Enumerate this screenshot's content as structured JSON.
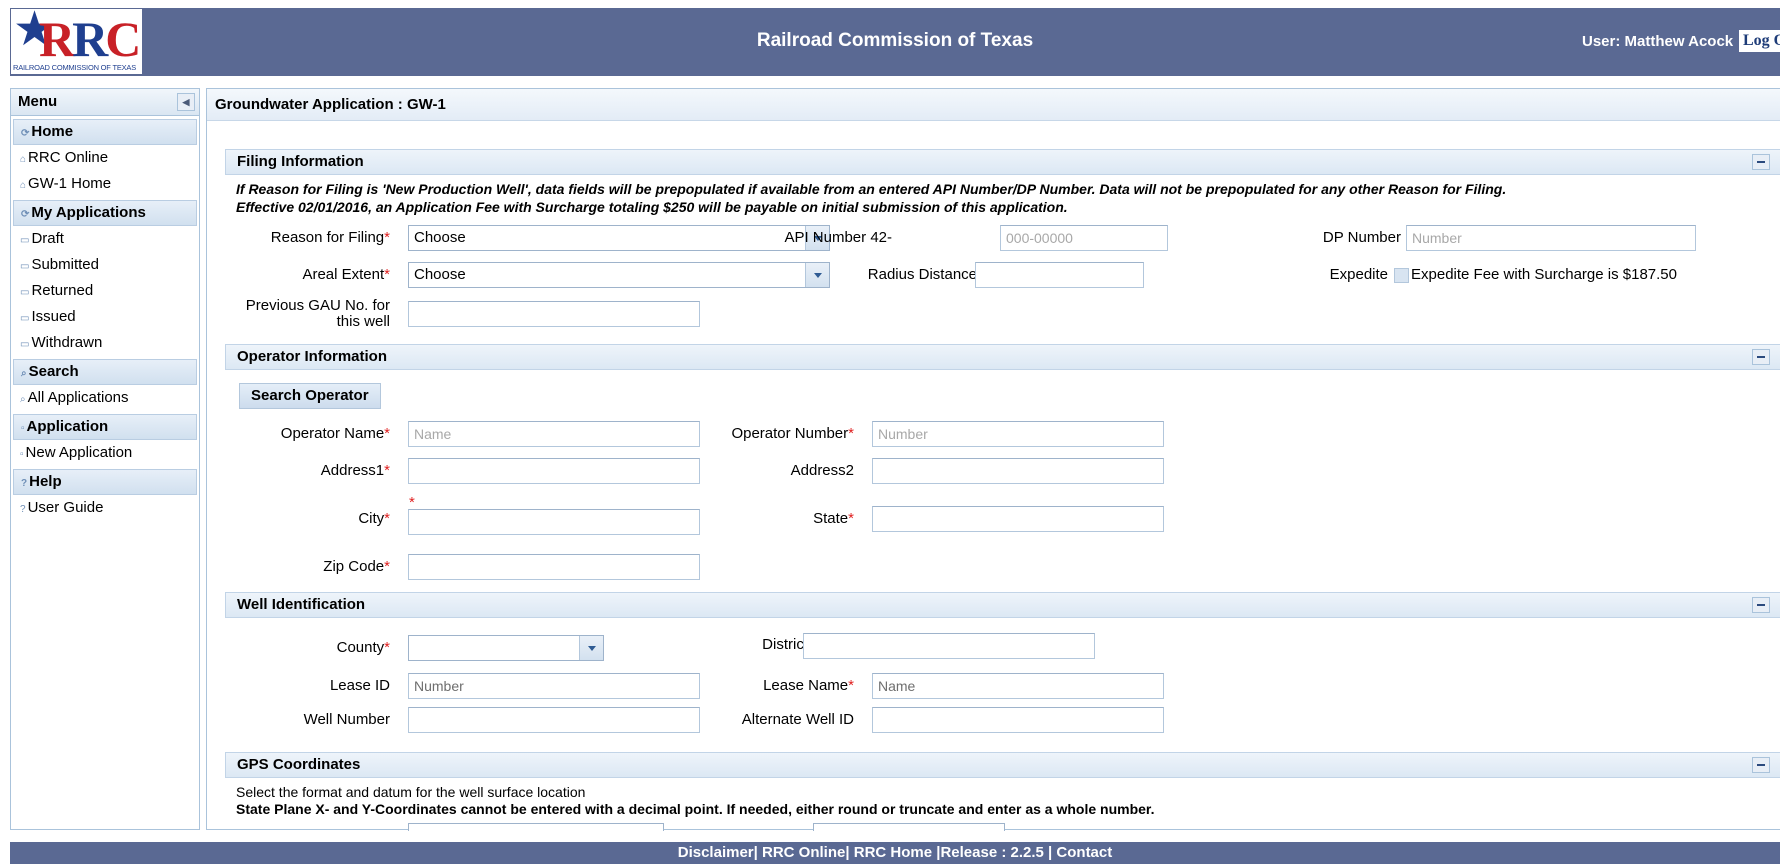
{
  "header": {
    "logo_letters": "RRC",
    "logo_caption": "RAILROAD COMMISSION OF TEXAS",
    "title": "Railroad Commission of Texas",
    "user_label": "User: Matthew Acock",
    "logout_label": "Log O"
  },
  "sidebar": {
    "title": "Menu",
    "sections": [
      {
        "label": "Home",
        "items": [
          "RRC Online",
          "GW-1 Home"
        ]
      },
      {
        "label": "My Applications",
        "items": [
          "Draft",
          "Submitted",
          "Returned",
          "Issued",
          "Withdrawn"
        ]
      },
      {
        "label": "Search",
        "items": [
          "All Applications"
        ]
      },
      {
        "label": "Application",
        "items": [
          "New Application"
        ]
      },
      {
        "label": "Help",
        "items": [
          "User Guide"
        ]
      }
    ]
  },
  "page_title": "Groundwater Application : GW-1",
  "filing": {
    "heading": "Filing Information",
    "note1": "If Reason for Filing is 'New Production Well', data fields will be prepopulated if available from an entered API Number/DP Number. Data will not be prepopulated for any other Reason for Filing.",
    "note2": "Effective 02/01/2016, an Application Fee with Surcharge totaling $250 will be payable on initial submission of this application.",
    "reason_label": "Reason for Filing",
    "reason_value": "Choose",
    "api_label": "API Number 42-",
    "api_placeholder": "000-00000",
    "dp_label": "DP Number",
    "dp_placeholder": "Number",
    "areal_label": "Areal Extent",
    "areal_value": "Choose",
    "radius_label": "Radius Distance",
    "expedite_label": "Expedite",
    "expedite_text": "Expedite Fee with Surcharge is $187.50",
    "prev_gau_label_1": "Previous GAU No. for",
    "prev_gau_label_2": "this well"
  },
  "operator": {
    "heading": "Operator Information",
    "search_button": "Search Operator",
    "name_label": "Operator Name",
    "name_placeholder": "Name",
    "number_label": "Operator Number",
    "number_placeholder": "Number",
    "address1_label": "Address1",
    "address2_label": "Address2",
    "city_label": "City",
    "state_label": "State",
    "zip_label": "Zip Code"
  },
  "well": {
    "heading": "Well Identification",
    "county_label": "County",
    "district_label": "District",
    "lease_id_label": "Lease ID",
    "lease_id_placeholder": "Number",
    "lease_name_label": "Lease Name",
    "lease_name_placeholder": "Name",
    "well_number_label": "Well Number",
    "alt_well_label": "Alternate Well ID"
  },
  "gps": {
    "heading": "GPS Coordinates",
    "note1": "Select the format and datum for the well surface location",
    "note2": "State Plane X- and Y-Coordinates cannot be entered with a decimal point. If needed, either round or truncate and enter as a whole number."
  },
  "footer": {
    "disclaimer": "Disclaimer",
    "rrc_online": "RRC Online",
    "rrc_home": "RRC Home",
    "release": "Release : 2.2.5",
    "contact": "Contact"
  },
  "colors": {
    "header_bg": "#5a6993",
    "panel_border": "#aac3db",
    "required": "#e02020"
  }
}
